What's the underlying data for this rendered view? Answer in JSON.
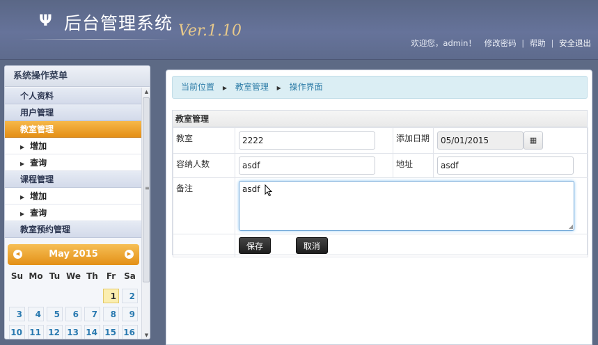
{
  "header": {
    "logo_glyph": "Ψ",
    "title": "后台管理系统",
    "version": "Ver.1.10",
    "welcome": "欢迎您，admin！",
    "change_password": "修改密码",
    "separator": "|",
    "help": "帮助",
    "logout": "安全退出"
  },
  "sidebar": {
    "title": "系统操作菜单",
    "items": [
      {
        "label": "个人资料",
        "kind": "group"
      },
      {
        "label": "用户管理",
        "kind": "group"
      },
      {
        "label": "教室管理",
        "kind": "group-active"
      },
      {
        "label": "增加",
        "kind": "sub"
      },
      {
        "label": "查询",
        "kind": "sub"
      },
      {
        "label": "课程管理",
        "kind": "group"
      },
      {
        "label": "增加",
        "kind": "sub"
      },
      {
        "label": "查询",
        "kind": "sub"
      },
      {
        "label": "教室预约管理",
        "kind": "group"
      }
    ],
    "calendar": {
      "month_label": "May 2015",
      "weekdays": [
        "Su",
        "Mo",
        "Tu",
        "We",
        "Th",
        "Fr",
        "Sa"
      ],
      "rows": [
        [
          "",
          "",
          "",
          "",
          "",
          "1",
          "2"
        ],
        [
          "3",
          "4",
          "5",
          "6",
          "7",
          "8",
          "9"
        ],
        [
          "10",
          "11",
          "12",
          "13",
          "14",
          "15",
          "16"
        ]
      ],
      "today": "1"
    }
  },
  "breadcrumb": {
    "items": [
      "当前位置",
      "教室管理",
      "操作界面"
    ]
  },
  "form": {
    "title": "教室管理",
    "classroom_label": "教室",
    "classroom_value": "2222",
    "date_label": "添加日期",
    "date_value": "05/01/2015",
    "capacity_label": "容纳人数",
    "capacity_value": "asdf",
    "address_label": "地址",
    "address_value": "asdf",
    "note_label": "备注",
    "note_value": "asdf",
    "save_label": "保存",
    "cancel_label": "取消"
  },
  "colors": {
    "header_bg": "#5d6a85",
    "menu_active": "#e48f16",
    "link": "#2f7ea8",
    "version": "#e8c98a"
  },
  "icons": {
    "logo": "psi-logo-icon",
    "breadcrumb_separator": "triangle-right-icon",
    "calendar_button": "calendar-icon",
    "calendar_prev": "chevron-left-icon",
    "calendar_next": "chevron-right-icon",
    "mouse_cursor": "cursor-pointer-icon"
  }
}
